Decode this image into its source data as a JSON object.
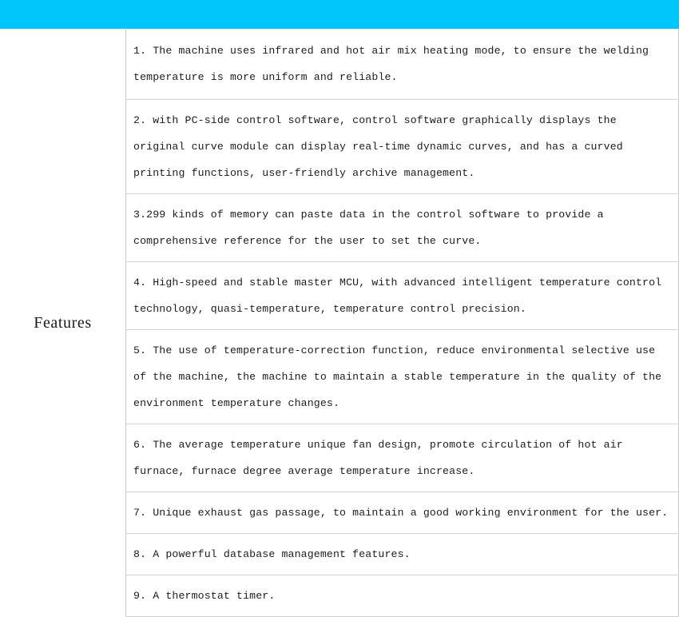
{
  "theme": {
    "accent_color": "#00c6fb",
    "text_color": "#1c1c1c",
    "border_color": "#c9c9c9",
    "background_color": "#ffffff"
  },
  "spec_table": {
    "row_label": "Features",
    "features": [
      {
        "index": "1",
        "text": "1. The machine uses infrared and hot air mix heating mode, to ensure the welding temperature is more uniform and reliable."
      },
      {
        "index": "2",
        "text": "2. with PC-side control software, control software graphically displays the original curve module can display real-time dynamic curves, and has a curved printing functions, user-friendly archive management."
      },
      {
        "index": "3",
        "text": "3.299 kinds of memory can paste data in the control software to provide a comprehensive reference for the user to set the curve."
      },
      {
        "index": "4",
        "text": "4. High-speed and stable master MCU, with advanced intelligent temperature control technology, quasi-temperature, temperature control precision."
      },
      {
        "index": "5",
        "text": "5. The use of temperature-correction function, reduce environmental selective use of the machine, the machine to maintain a stable temperature in the quality of the environment temperature changes."
      },
      {
        "index": "6",
        "text": "6. The average temperature unique fan design, promote circulation of hot air furnace, furnace degree average temperature increase."
      },
      {
        "index": "7",
        "text": "7. Unique exhaust gas passage, to maintain a good working environment for the user."
      },
      {
        "index": "8",
        "text": "8. A powerful database management features."
      },
      {
        "index": "9",
        "text": "9. A thermostat timer."
      }
    ]
  }
}
